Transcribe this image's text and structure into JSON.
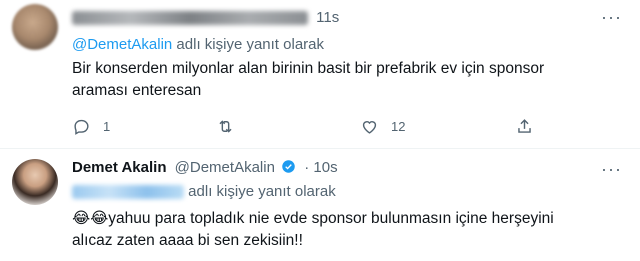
{
  "reply_tweet": {
    "time": "11s",
    "replying_to_prefix": "@DemetAkalin",
    "replying_to_suffix": " adlı kişiye yanıt olarak",
    "text_line1": "Bir konserden milyonlar alan birinin basit bir prefabrik ev için sponsor",
    "text_line2": "araması enteresan",
    "reply_count": "1",
    "retweet_count": "",
    "like_count": "12",
    "more_label": "···"
  },
  "author_tweet": {
    "display_name": "Demet Akalin",
    "handle": "@DemetAkalin",
    "time": "· 10s",
    "replying_to_suffix": "adlı kişiye yanıt olarak",
    "emoji_prefix": "😂😂",
    "text_line1": "yahuu para topladık nie evde sponsor bulunmasın içine herşeyini",
    "text_line2": "alıcaz zaten aaaa bi sen zekisiin!!",
    "more_label": "···"
  },
  "colors": {
    "accent": "#1d9bf0",
    "secondary_text": "#536471",
    "primary_text": "#0f1419"
  }
}
